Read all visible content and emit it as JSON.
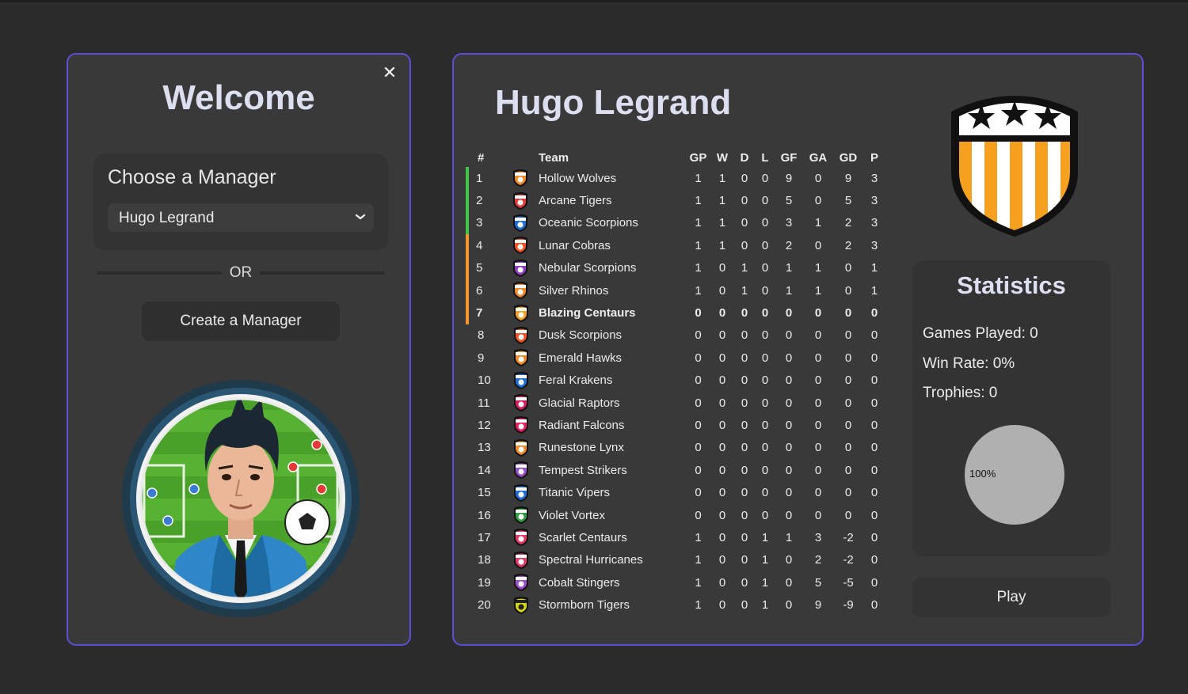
{
  "welcome": {
    "title": "Welcome",
    "close_symbol": "✕",
    "choose_label": "Choose a Manager",
    "selected_manager": "Hugo Legrand",
    "or_text": "OR",
    "create_label": "Create a Manager",
    "avatar_icon": "manager-avatar-icon"
  },
  "manager": {
    "name": "Hugo Legrand",
    "crest_colors": {
      "stripe_a": "#f5a01e",
      "stripe_b": "#ffffff",
      "outline": "#111111",
      "star": "#111111"
    }
  },
  "table": {
    "headers": [
      "#",
      "Team",
      "GP",
      "W",
      "D",
      "L",
      "GF",
      "GA",
      "GD",
      "P"
    ],
    "rows": [
      {
        "pos": "1",
        "team": "Hollow Wolves",
        "gp": "1",
        "w": "1",
        "d": "0",
        "l": "0",
        "gf": "9",
        "ga": "0",
        "gd": "9",
        "p": "3",
        "zone": "green",
        "c1": "#f08a24",
        "c2": "#ffffff"
      },
      {
        "pos": "2",
        "team": "Arcane Tigers",
        "gp": "1",
        "w": "1",
        "d": "0",
        "l": "0",
        "gf": "5",
        "ga": "0",
        "gd": "5",
        "p": "3",
        "zone": "green",
        "c1": "#e53935",
        "c2": "#ffffff"
      },
      {
        "pos": "3",
        "team": "Oceanic Scorpions",
        "gp": "1",
        "w": "1",
        "d": "0",
        "l": "0",
        "gf": "3",
        "ga": "1",
        "gd": "2",
        "p": "3",
        "zone": "green",
        "c1": "#1e6fd9",
        "c2": "#ffffff"
      },
      {
        "pos": "4",
        "team": "Lunar Cobras",
        "gp": "1",
        "w": "1",
        "d": "0",
        "l": "0",
        "gf": "2",
        "ga": "0",
        "gd": "2",
        "p": "3",
        "zone": "orange",
        "c1": "#f4511e",
        "c2": "#ffffff"
      },
      {
        "pos": "5",
        "team": "Nebular Scorpions",
        "gp": "1",
        "w": "0",
        "d": "1",
        "l": "0",
        "gf": "1",
        "ga": "1",
        "gd": "0",
        "p": "1",
        "zone": "orange",
        "c1": "#8e3fbf",
        "c2": "#ffffff"
      },
      {
        "pos": "6",
        "team": "Silver Rhinos",
        "gp": "1",
        "w": "0",
        "d": "1",
        "l": "0",
        "gf": "1",
        "ga": "1",
        "gd": "0",
        "p": "1",
        "zone": "orange",
        "c1": "#f08a24",
        "c2": "#ffffff"
      },
      {
        "pos": "7",
        "team": "Blazing Centaurs",
        "gp": "0",
        "w": "0",
        "d": "0",
        "l": "0",
        "gf": "0",
        "ga": "0",
        "gd": "0",
        "p": "0",
        "zone": "orange",
        "selected": true,
        "c1": "#f5a01e",
        "c2": "#ffffff"
      },
      {
        "pos": "8",
        "team": "Dusk Scorpions",
        "gp": "0",
        "w": "0",
        "d": "0",
        "l": "0",
        "gf": "0",
        "ga": "0",
        "gd": "0",
        "p": "0",
        "zone": "",
        "c1": "#f4511e",
        "c2": "#ffffff"
      },
      {
        "pos": "9",
        "team": "Emerald Hawks",
        "gp": "0",
        "w": "0",
        "d": "0",
        "l": "0",
        "gf": "0",
        "ga": "0",
        "gd": "0",
        "p": "0",
        "zone": "",
        "c1": "#f08a24",
        "c2": "#ffffff"
      },
      {
        "pos": "10",
        "team": "Feral Krakens",
        "gp": "0",
        "w": "0",
        "d": "0",
        "l": "0",
        "gf": "0",
        "ga": "0",
        "gd": "0",
        "p": "0",
        "zone": "",
        "c1": "#1e6fd9",
        "c2": "#ffffff"
      },
      {
        "pos": "11",
        "team": "Glacial Raptors",
        "gp": "0",
        "w": "0",
        "d": "0",
        "l": "0",
        "gf": "0",
        "ga": "0",
        "gd": "0",
        "p": "0",
        "zone": "",
        "c1": "#d81b60",
        "c2": "#ffffff"
      },
      {
        "pos": "12",
        "team": "Radiant Falcons",
        "gp": "0",
        "w": "0",
        "d": "0",
        "l": "0",
        "gf": "0",
        "ga": "0",
        "gd": "0",
        "p": "0",
        "zone": "",
        "c1": "#e91e63",
        "c2": "#ffffff"
      },
      {
        "pos": "13",
        "team": "Runestone Lynx",
        "gp": "0",
        "w": "0",
        "d": "0",
        "l": "0",
        "gf": "0",
        "ga": "0",
        "gd": "0",
        "p": "0",
        "zone": "",
        "c1": "#f08a24",
        "c2": "#ffffff"
      },
      {
        "pos": "14",
        "team": "Tempest Strikers",
        "gp": "0",
        "w": "0",
        "d": "0",
        "l": "0",
        "gf": "0",
        "ga": "0",
        "gd": "0",
        "p": "0",
        "zone": "",
        "c1": "#9c4dcc",
        "c2": "#ffffff"
      },
      {
        "pos": "15",
        "team": "Titanic Vipers",
        "gp": "0",
        "w": "0",
        "d": "0",
        "l": "0",
        "gf": "0",
        "ga": "0",
        "gd": "0",
        "p": "0",
        "zone": "",
        "c1": "#1e6fd9",
        "c2": "#ffffff"
      },
      {
        "pos": "16",
        "team": "Violet Vortex",
        "gp": "0",
        "w": "0",
        "d": "0",
        "l": "0",
        "gf": "0",
        "ga": "0",
        "gd": "0",
        "p": "0",
        "zone": "",
        "c1": "#2e9e3e",
        "c2": "#ffffff"
      },
      {
        "pos": "17",
        "team": "Scarlet Centaurs",
        "gp": "1",
        "w": "0",
        "d": "0",
        "l": "1",
        "gf": "1",
        "ga": "3",
        "gd": "-2",
        "p": "0",
        "zone": "",
        "c1": "#e53966",
        "c2": "#ffffff"
      },
      {
        "pos": "18",
        "team": "Spectral Hurricanes",
        "gp": "1",
        "w": "0",
        "d": "0",
        "l": "1",
        "gf": "0",
        "ga": "2",
        "gd": "-2",
        "p": "0",
        "zone": "",
        "c1": "#e53966",
        "c2": "#ffffff"
      },
      {
        "pos": "19",
        "team": "Cobalt Stingers",
        "gp": "1",
        "w": "0",
        "d": "0",
        "l": "1",
        "gf": "0",
        "ga": "5",
        "gd": "-5",
        "p": "0",
        "zone": "",
        "c1": "#a24bd1",
        "c2": "#ffffff"
      },
      {
        "pos": "20",
        "team": "Stormborn Tigers",
        "gp": "1",
        "w": "0",
        "d": "0",
        "l": "1",
        "gf": "0",
        "ga": "9",
        "gd": "-9",
        "p": "0",
        "zone": "",
        "c1": "#d4d40f",
        "c2": "#222222"
      }
    ]
  },
  "stats": {
    "title": "Statistics",
    "games_played": "Games Played: 0",
    "win_rate": "Win Rate: 0%",
    "trophies": "Trophies: 0",
    "pie_label": "100%",
    "pie_color": "#b0b0b0"
  },
  "play_label": "Play",
  "colors": {
    "accent_border": "#5b4fd8",
    "zone_green": "#41c64a",
    "zone_orange": "#f5962e"
  }
}
